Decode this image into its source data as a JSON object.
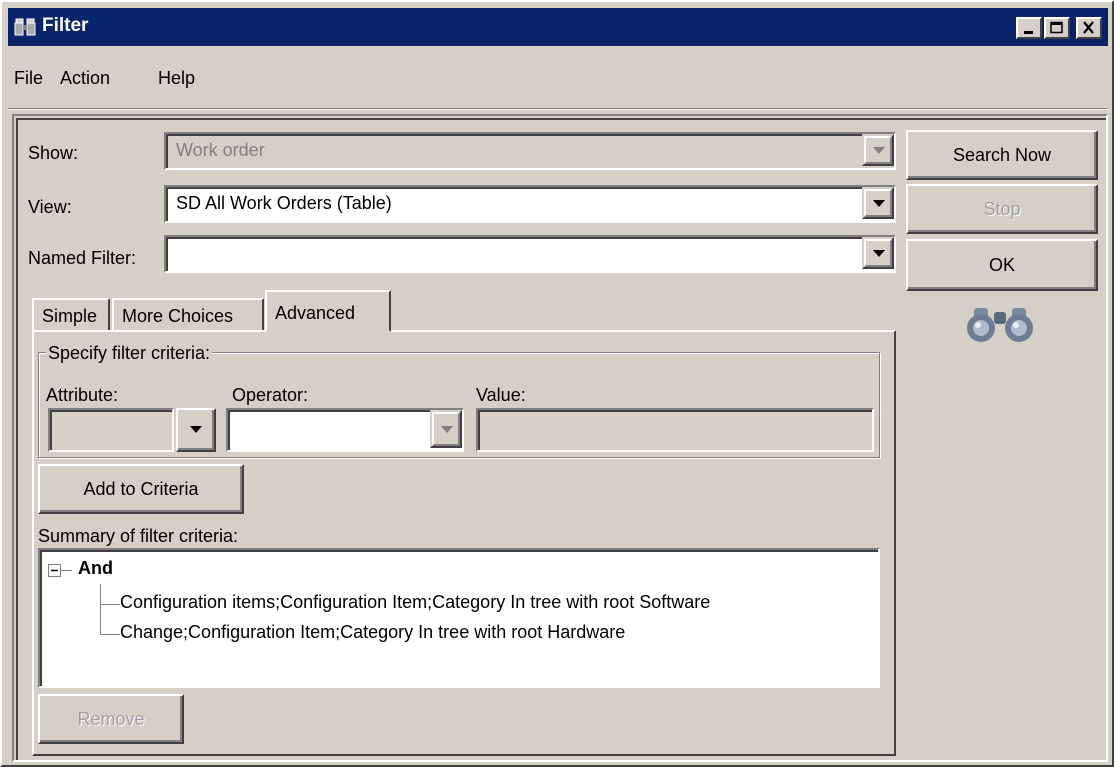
{
  "window": {
    "title": "Filter"
  },
  "menu": {
    "file": "File",
    "action": "Action",
    "help": "Help"
  },
  "form": {
    "show_label": "Show:",
    "show_value": "Work order",
    "view_label": "View:",
    "view_value": "SD All Work Orders (Table)",
    "named_filter_label": "Named Filter:",
    "named_filter_value": ""
  },
  "actions": {
    "search_now": "Search Now",
    "stop": "Stop",
    "ok": "OK"
  },
  "tabs": [
    {
      "label": "Simple"
    },
    {
      "label": "More Choices"
    },
    {
      "label": "Advanced"
    }
  ],
  "criteria": {
    "group_title": "Specify filter criteria:",
    "attribute_label": "Attribute:",
    "attribute_value": "",
    "operator_label": "Operator:",
    "operator_value": "",
    "value_label": "Value:",
    "value_value": "",
    "add_button": "Add to Criteria",
    "summary_label": "Summary of filter criteria:",
    "root": "And",
    "items": [
      "Configuration items;Configuration Item;Category In tree with root Software",
      "Change;Configuration Item;Category In tree with root Hardware"
    ],
    "remove_button": "Remove"
  },
  "colors": {
    "title_bar": "#0a246a",
    "face": "#d4d0c8"
  }
}
